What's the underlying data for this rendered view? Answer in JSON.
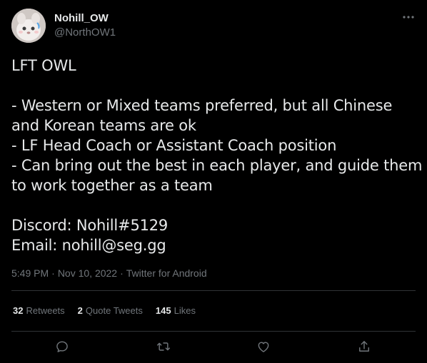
{
  "author": {
    "display_name": "Nohill_OW",
    "handle": "@NorthOW1",
    "avatar_icon": "avatar-image"
  },
  "tweet": {
    "lines": [
      "LFT OWL",
      "",
      "- Western or Mixed teams preferred, but all Chinese",
      "and Korean teams are ok",
      "- LF Head Coach or Assistant Coach position",
      "- Can bring out the best in each player, and guide them",
      "to work together as a team",
      "",
      "Discord: Nohill#5129",
      "Email: nohill@seg.gg"
    ],
    "time": "5:49 PM",
    "date": "Nov 10, 2022",
    "source": "Twitter for Android",
    "separator": "·"
  },
  "stats": {
    "retweets_count": "32",
    "retweets_label": "Retweets",
    "quotes_count": "2",
    "quotes_label": "Quote Tweets",
    "likes_count": "145",
    "likes_label": "Likes"
  },
  "actions": {
    "reply_icon": "reply-icon",
    "retweet_icon": "retweet-icon",
    "like_icon": "like-icon",
    "share_icon": "share-icon"
  },
  "colors": {
    "background": "#000000",
    "text_primary": "#e7e9ea",
    "text_secondary": "#71767b",
    "divider": "#2f3336"
  }
}
